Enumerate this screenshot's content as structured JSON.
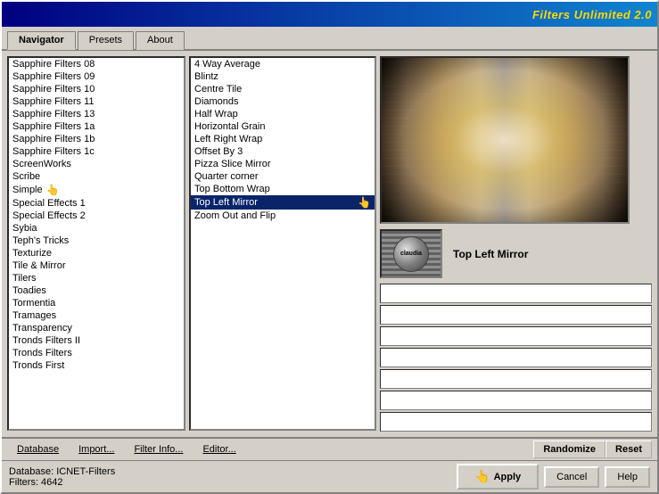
{
  "titleBar": {
    "title": "Filters Unlimited 2.0"
  },
  "tabs": [
    {
      "id": "navigator",
      "label": "Navigator",
      "active": true
    },
    {
      "id": "presets",
      "label": "Presets",
      "active": false
    },
    {
      "id": "about",
      "label": "About",
      "active": false
    }
  ],
  "leftList": {
    "items": [
      "Sapphire Filters 08",
      "Sapphire Filters 09",
      "Sapphire Filters 10",
      "Sapphire Filters 11",
      "Sapphire Filters 13",
      "Sapphire Filters 1a",
      "Sapphire Filters 1b",
      "Sapphire Filters 1c",
      "ScreenWorks",
      "Scribe",
      "Simple",
      "Special Effects 1",
      "Special Effects 2",
      "Sybia",
      "Teph's Tricks",
      "Texturize",
      "Tile & Mirror",
      "Tilers",
      "Toadies",
      "Tormentia",
      "Tramages",
      "Transparency",
      "Tronds Filters II",
      "Tronds Filters",
      "Tronds First"
    ]
  },
  "rightList": {
    "items": [
      "4 Way Average",
      "Blintz",
      "Centre Tile",
      "Diamonds",
      "Half Wrap",
      "Horizontal Grain",
      "Left Right Wrap",
      "Offset By 3",
      "Pizza Slice Mirror",
      "Quarter corner",
      "Top Bottom Wrap",
      "Top Left Mirror",
      "Zoom Out and Flip"
    ],
    "selectedItem": "Top Left Mirror"
  },
  "preview": {
    "thumbLabel": "claudia",
    "filterName": "Top Left Mirror"
  },
  "toolbar": {
    "database": "Database",
    "import": "Import...",
    "filterInfo": "Filter Info...",
    "editor": "Editor...",
    "randomize": "Randomize",
    "reset": "Reset"
  },
  "statusBar": {
    "databaseLabel": "Database:",
    "databaseValue": "ICNET-Filters",
    "filtersLabel": "Filters:",
    "filtersValue": "4642",
    "applyLabel": "Apply",
    "cancelLabel": "Cancel",
    "helpLabel": "Help"
  }
}
